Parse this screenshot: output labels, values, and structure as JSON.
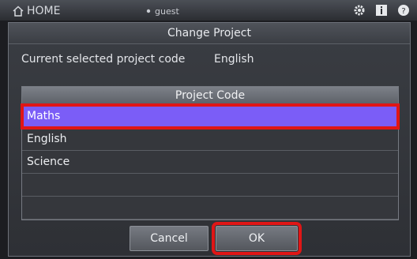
{
  "topbar": {
    "home_label": "HOME",
    "user_label": "guest",
    "icons": [
      "home-icon",
      "user-icon",
      "gear-icon",
      "info-icon",
      "help-icon"
    ]
  },
  "dialog": {
    "title": "Change Project",
    "current_label": "Current selected project code",
    "current_value": "English",
    "table_header": "Project Code",
    "rows": [
      "Maths",
      "English",
      "Science",
      "",
      ""
    ],
    "selected_row": "Maths",
    "cancel_label": "Cancel",
    "ok_label": "OK"
  },
  "colors": {
    "selection": "#7b5df7",
    "highlight_box": "#e01616"
  }
}
